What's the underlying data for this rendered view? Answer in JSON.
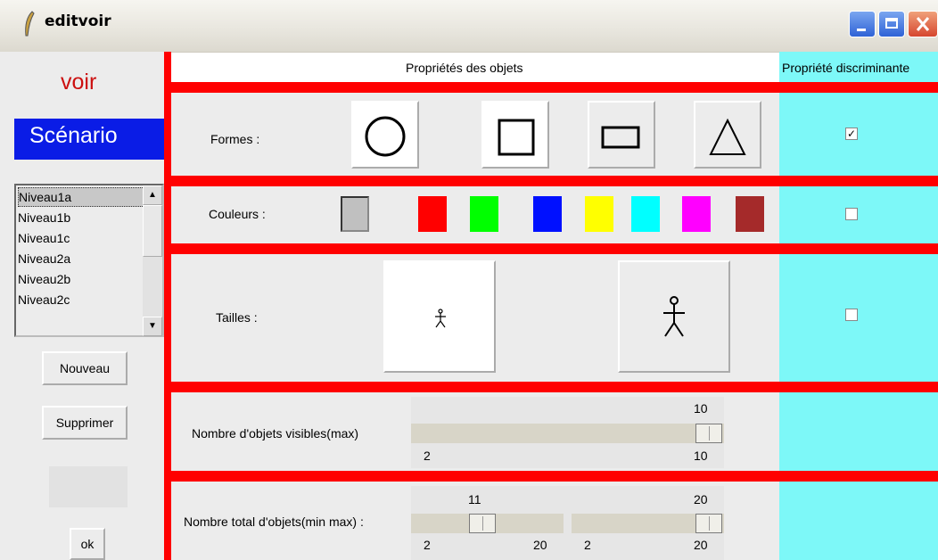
{
  "window": {
    "title": "editvoir",
    "icon": "feather-icon"
  },
  "sidebar": {
    "voir_label": "voir",
    "scenario_label": "Scénario",
    "levels": [
      "Niveau1a",
      "Niveau1b",
      "Niveau1c",
      "Niveau2a",
      "Niveau2b",
      "Niveau2c"
    ],
    "selected_level": "Niveau1a",
    "new_button": "Nouveau",
    "delete_button": "Supprimer",
    "ok_button": "ok"
  },
  "header": {
    "properties_title": "Propriétés des objets",
    "discriminant_title": "Propriété discriminante"
  },
  "formes": {
    "label": "Formes :",
    "shapes": [
      "circle-shape",
      "square-shape",
      "rectangle-shape",
      "triangle-shape"
    ],
    "discriminant": true
  },
  "couleurs": {
    "label": "Couleurs :",
    "colors": [
      "#c0c0c0",
      "#ff0000",
      "#00ff00",
      "#0010ff",
      "#ffff00",
      "#00ffff",
      "#ff00ff",
      "#a52a2a"
    ],
    "discriminant": false
  },
  "tailles": {
    "label": "Tailles :",
    "sizes": [
      "small-stick-figure",
      "large-stick-figure"
    ],
    "discriminant": false
  },
  "visible_count": {
    "label": "Nombre d'objets visibles(max)",
    "value": "10",
    "min": "2",
    "max": "10"
  },
  "total_count": {
    "label": "Nombre total d'objets(min max) :",
    "min_value": "11",
    "max_value": "20",
    "min_slider_min": "2",
    "min_slider_max": "20",
    "max_slider_min": "2",
    "max_slider_max": "20"
  },
  "colors": {
    "accent_red": "#ff0000",
    "cyan": "#7df8f8",
    "scenario_blue": "#0a1ce6"
  }
}
